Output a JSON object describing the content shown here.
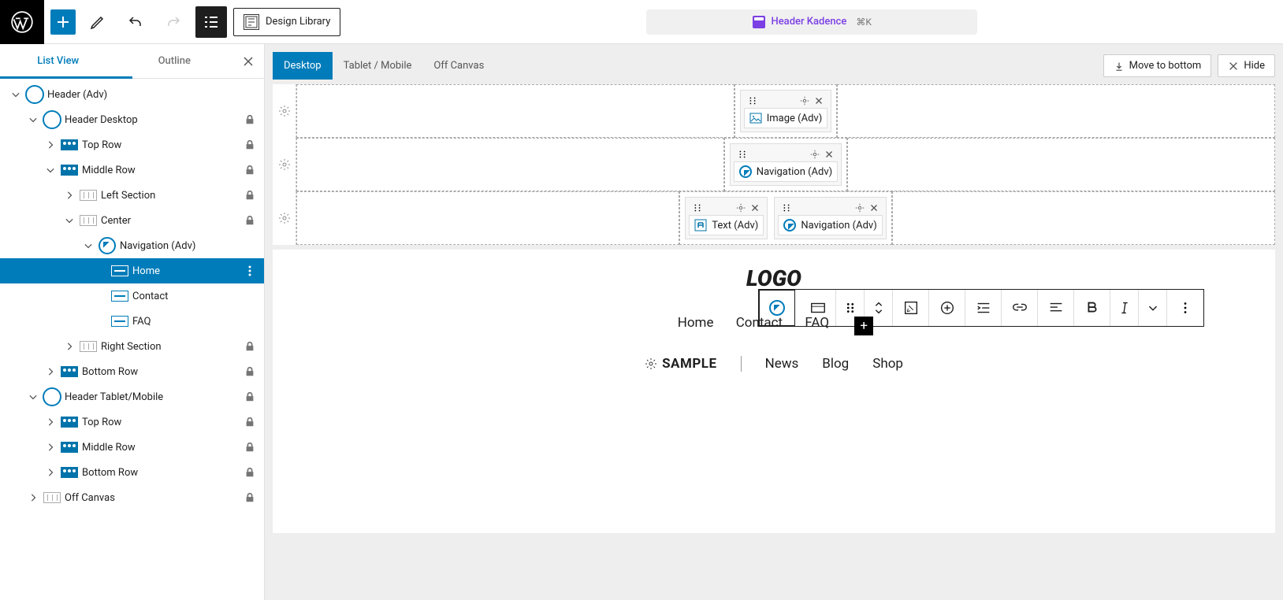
{
  "toolbar": {
    "design_library": "Design Library",
    "header_chip": "Header Kadence",
    "shortcut": "⌘K"
  },
  "panel": {
    "tabs": {
      "list_view": "List View",
      "outline": "Outline"
    }
  },
  "tree": {
    "header_adv": "Header (Adv)",
    "header_desktop": "Header Desktop",
    "top_row": "Top Row",
    "middle_row": "Middle Row",
    "left_section": "Left Section",
    "center": "Center",
    "navigation_adv": "Navigation (Adv)",
    "home": "Home",
    "contact": "Contact",
    "faq": "FAQ",
    "right_section": "Right Section",
    "bottom_row": "Bottom Row",
    "header_tablet": "Header Tablet/Mobile",
    "top_row2": "Top Row",
    "middle_row2": "Middle Row",
    "bottom_row2": "Bottom Row",
    "off_canvas": "Off Canvas"
  },
  "device_tabs": {
    "desktop": "Desktop",
    "tablet": "Tablet / Mobile",
    "off_canvas": "Off Canvas"
  },
  "canvas_actions": {
    "move_bottom": "Move to bottom",
    "hide": "Hide"
  },
  "builder": {
    "image_adv": "Image (Adv)",
    "navigation_adv": "Navigation (Adv)",
    "text_adv": "Text (Adv)",
    "navigation_adv2": "Navigation (Adv)"
  },
  "preview": {
    "logo": "LOGO",
    "nav": {
      "home": "Home",
      "contact": "Contact",
      "faq": "FAQ"
    },
    "sample": "SAMPLE",
    "bottom": {
      "news": "News",
      "blog": "Blog",
      "shop": "Shop"
    }
  }
}
